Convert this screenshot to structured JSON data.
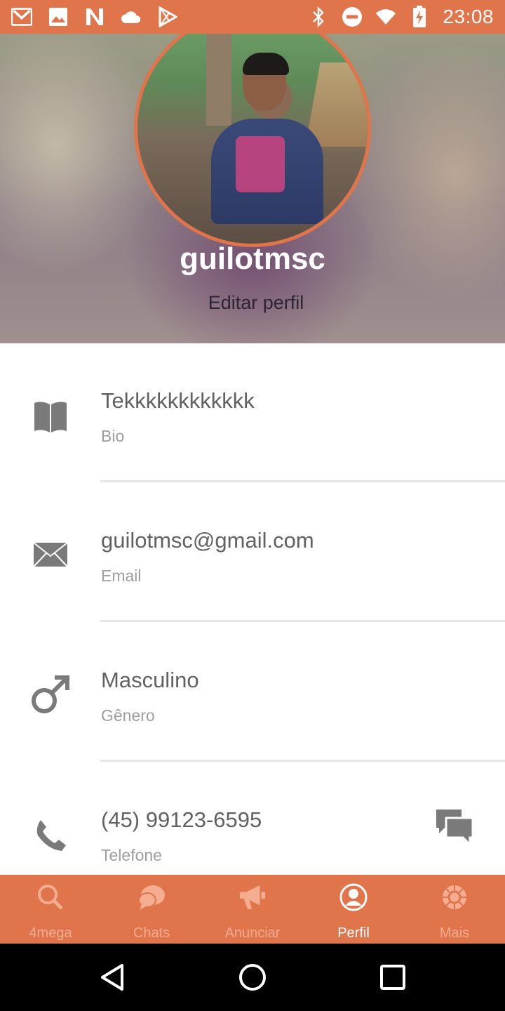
{
  "status_bar": {
    "time": "23:08",
    "left_icons": [
      "gmail-icon",
      "photo-icon",
      "n-app-icon",
      "cloud-icon",
      "play-store-icon"
    ],
    "right_icons": [
      "bluetooth-icon",
      "do-not-disturb-icon",
      "wifi-icon",
      "battery-charging-icon"
    ]
  },
  "profile": {
    "username": "guilotmsc",
    "edit_label": "Editar perfil"
  },
  "fields": [
    {
      "icon": "book-icon",
      "value": "Tekkkkkkkkkkkk",
      "label": "Bio"
    },
    {
      "icon": "envelope-icon",
      "value": "guilotmsc@gmail.com",
      "label": "Email"
    },
    {
      "icon": "male-gender-icon",
      "value": "Masculino",
      "label": "Gênero"
    },
    {
      "icon": "phone-icon",
      "value": "(45) 99123-6595",
      "label": "Telefone",
      "action_icon": "chat-bubbles-icon"
    }
  ],
  "bottom_nav": {
    "items": [
      {
        "label": "4mega",
        "icon": "search-icon"
      },
      {
        "label": "Chats",
        "icon": "chat-icon"
      },
      {
        "label": "Anunciar",
        "icon": "megaphone-icon"
      },
      {
        "label": "Perfil",
        "icon": "profile-icon",
        "active": true
      },
      {
        "label": "Mais",
        "icon": "gear-icon"
      }
    ]
  },
  "colors": {
    "accent": "#E0744A",
    "nav_inactive_label": "#f4ad90",
    "value_text": "#616161",
    "label_text": "#9e9e9e"
  }
}
